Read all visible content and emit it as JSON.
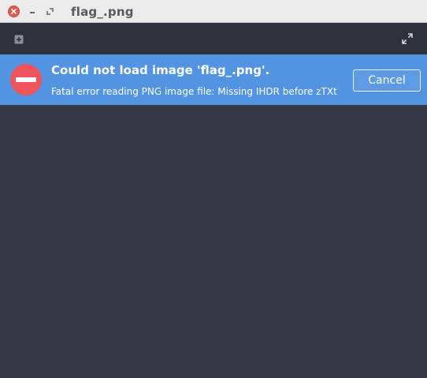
{
  "window": {
    "title": "flag_.png"
  },
  "titlebar": {
    "close_icon": "close-icon",
    "minimize_icon": "minimize-icon",
    "maximize_icon": "maximize-icon"
  },
  "toolbar": {
    "add_icon": "add-icon",
    "fullscreen_icon": "fullscreen-icon"
  },
  "infobar": {
    "icon": "error-icon",
    "title": "Could not load image 'flag_.png'.",
    "detail": "Fatal error reading PNG image file: Missing IHDR before zTXt",
    "cancel_label": "Cancel"
  },
  "colors": {
    "infobar_bg": "#5294e2",
    "error_icon": "#f0535a",
    "content_bg": "#353945",
    "toolbar_bg": "#2f323c",
    "titlebar_bg": "#ecebeb"
  }
}
